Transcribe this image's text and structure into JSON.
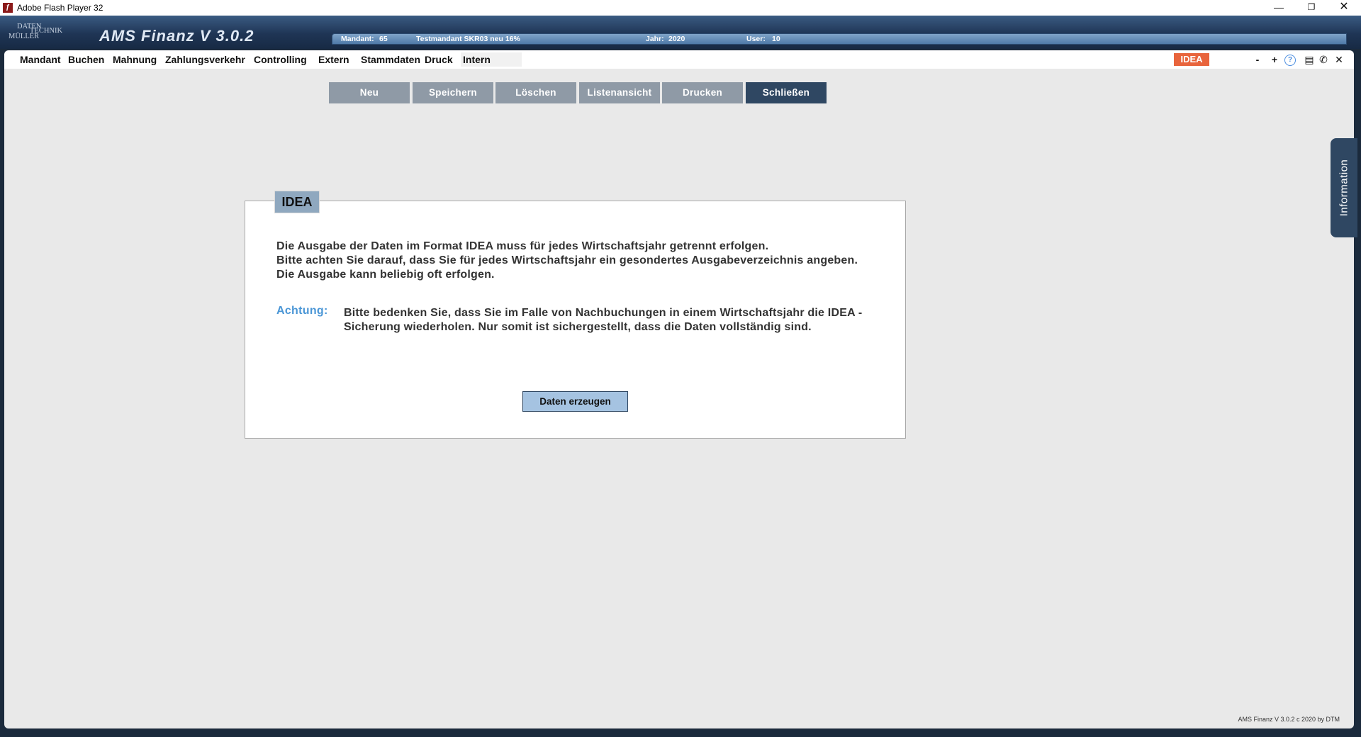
{
  "window": {
    "title": "Adobe Flash Player 32",
    "icon": "flash-icon",
    "controls": {
      "minimize": "—",
      "maximize": "❐",
      "close": "✕"
    }
  },
  "header": {
    "logo_line1": "DATEN",
    "logo_line2": "TECHNIK",
    "logo_line3": "MÜLLER",
    "app_name": "AMS Finanz V 3.0.2",
    "mandant_label": "Mandant:",
    "mandant_value": "65",
    "mandant_name": "Testmandant SKR03 neu 16%",
    "jahr_label": "Jahr:",
    "jahr_value": "2020",
    "user_label": "User:",
    "user_value": "10"
  },
  "menu": {
    "items": [
      {
        "label": "Mandant"
      },
      {
        "label": "Buchen"
      },
      {
        "label": "Mahnung"
      },
      {
        "label": "Zahlungsverkehr"
      },
      {
        "label": "Controlling"
      },
      {
        "label": "Extern"
      },
      {
        "label": "Stammdaten"
      },
      {
        "label": "Druck"
      },
      {
        "label": "Intern"
      }
    ],
    "badge": "IDEA",
    "tools": {
      "minus": "-",
      "plus": "+",
      "help": "?",
      "save": "▤",
      "phone": "✆",
      "close": "✕"
    }
  },
  "toolbar": {
    "buttons": [
      {
        "label": "Neu"
      },
      {
        "label": "Speichern"
      },
      {
        "label": "Löschen"
      },
      {
        "label": "Listenansicht"
      },
      {
        "label": "Drucken"
      },
      {
        "label": "Schließen"
      }
    ]
  },
  "panel": {
    "tab": "IDEA",
    "line1": "Die Ausgabe der Daten im Format IDEA muss für jedes Wirtschaftsjahr getrennt erfolgen.",
    "line2": "Bitte achten Sie darauf, dass Sie für jedes Wirtschaftsjahr ein gesondertes Ausgabeverzeichnis angeben.",
    "line3": "Die Ausgabe kann beliebig oft erfolgen.",
    "warn_label": "Achtung:",
    "warn_text": "Bitte bedenken Sie, dass Sie im Falle von Nachbuchungen in einem Wirtschaftsjahr die IDEA - Sicherung wiederholen. Nur somit ist sichergestellt, dass die Daten vollständig sind.",
    "button": "Daten erzeugen"
  },
  "side_tab": "Information",
  "footer": "AMS Finanz V 3.0.2 c  2020 by DTM",
  "colors": {
    "accent": "#2f4762",
    "toolbar_button": "#8f9aa6",
    "badge": "#e8643c",
    "warn": "#4a96d6"
  }
}
